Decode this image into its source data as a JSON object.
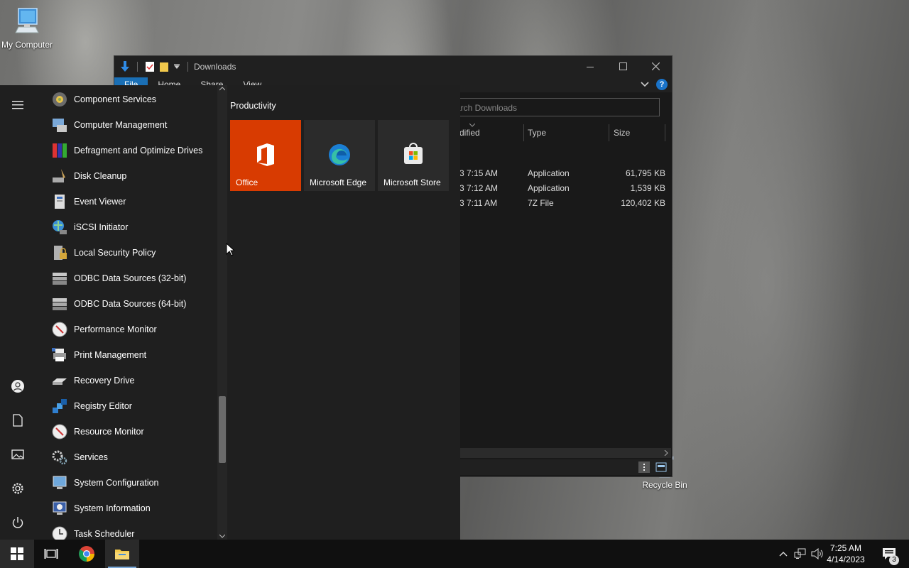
{
  "desktop": {
    "icons": [
      {
        "label": "My Computer"
      },
      {
        "label": "Recycle Bin"
      }
    ]
  },
  "explorer": {
    "title": "Downloads",
    "ribbon_tabs": [
      "File",
      "Home",
      "Share",
      "View"
    ],
    "search_placeholder": "arch Downloads",
    "columns": {
      "modified": "dified",
      "type": "Type",
      "size": "Size"
    },
    "rows": [
      {
        "modified": "3 7:15 AM",
        "type": "Application",
        "size": "61,795 KB"
      },
      {
        "modified": "3 7:12 AM",
        "type": "Application",
        "size": "1,539 KB"
      },
      {
        "modified": "3 7:11 AM",
        "type": "7Z File",
        "size": "120,402 KB"
      }
    ],
    "help_label": "?"
  },
  "start_menu": {
    "apps": [
      {
        "label": "Component Services",
        "icon": "component-services-icon"
      },
      {
        "label": "Computer Management",
        "icon": "computer-management-icon"
      },
      {
        "label": "Defragment and Optimize Drives",
        "icon": "defragment-icon"
      },
      {
        "label": "Disk Cleanup",
        "icon": "disk-cleanup-icon"
      },
      {
        "label": "Event Viewer",
        "icon": "event-viewer-icon"
      },
      {
        "label": "iSCSI Initiator",
        "icon": "iscsi-icon"
      },
      {
        "label": "Local Security Policy",
        "icon": "security-policy-icon"
      },
      {
        "label": "ODBC Data Sources (32-bit)",
        "icon": "odbc-icon"
      },
      {
        "label": "ODBC Data Sources (64-bit)",
        "icon": "odbc-icon"
      },
      {
        "label": "Performance Monitor",
        "icon": "performance-monitor-icon"
      },
      {
        "label": "Print Management",
        "icon": "print-management-icon"
      },
      {
        "label": "Recovery Drive",
        "icon": "recovery-drive-icon"
      },
      {
        "label": "Registry Editor",
        "icon": "registry-editor-icon"
      },
      {
        "label": "Resource Monitor",
        "icon": "resource-monitor-icon"
      },
      {
        "label": "Services",
        "icon": "services-icon"
      },
      {
        "label": "System Configuration",
        "icon": "system-configuration-icon"
      },
      {
        "label": "System Information",
        "icon": "system-information-icon"
      },
      {
        "label": "Task Scheduler",
        "icon": "task-scheduler-icon"
      }
    ],
    "tiles_group": "Productivity",
    "tiles": [
      {
        "label": "Office",
        "color": "#d83b01"
      },
      {
        "label": "Microsoft Edge",
        "color": "#2b2b2b"
      },
      {
        "label": "Microsoft Store",
        "color": "#2b2b2b"
      }
    ]
  },
  "taskbar": {
    "time": "7:25 AM",
    "date": "4/14/2023",
    "notification_count": "3"
  },
  "colors": {
    "accent": "#1a6fb5",
    "office": "#d83b01",
    "taskbar": "#101010"
  }
}
